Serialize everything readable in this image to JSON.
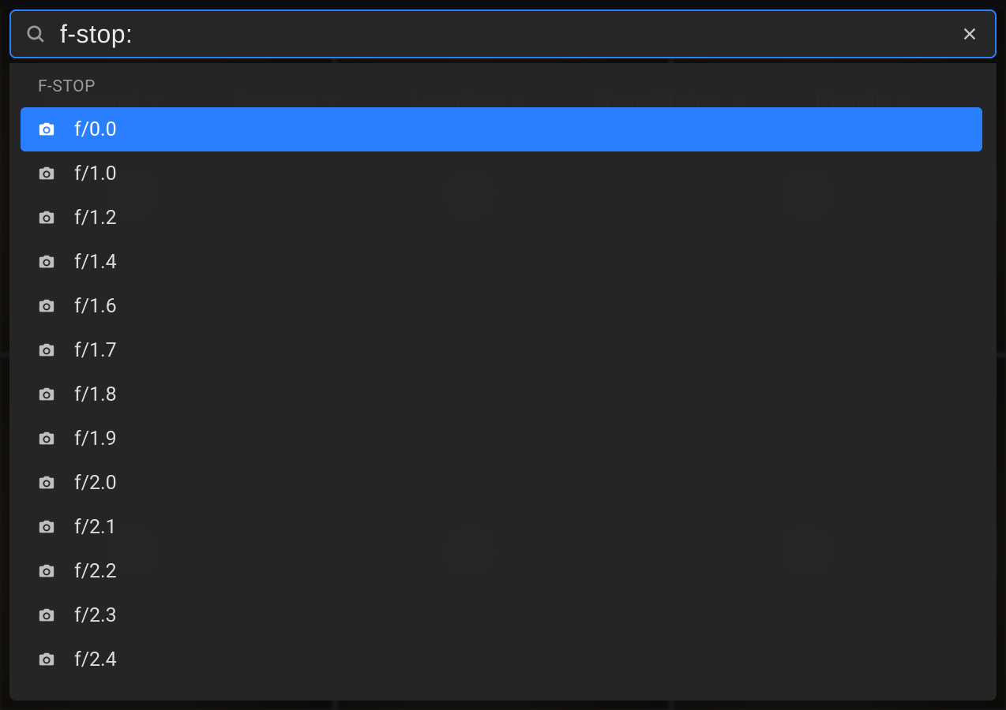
{
  "search": {
    "value": "f-stop:",
    "placeholder": "Search"
  },
  "filters": {
    "items": [
      {
        "label": "Keyword"
      },
      {
        "label": "Camera"
      },
      {
        "label": "Location"
      },
      {
        "label": "Sync Status"
      },
      {
        "label": "People"
      }
    ]
  },
  "dropdown": {
    "header": "F-STOP",
    "selected_index": 0,
    "options": [
      {
        "label": "f/0.0"
      },
      {
        "label": "f/1.0"
      },
      {
        "label": "f/1.2"
      },
      {
        "label": "f/1.4"
      },
      {
        "label": "f/1.6"
      },
      {
        "label": "f/1.7"
      },
      {
        "label": "f/1.8"
      },
      {
        "label": "f/1.9"
      },
      {
        "label": "f/2.0"
      },
      {
        "label": "f/2.1"
      },
      {
        "label": "f/2.2"
      },
      {
        "label": "f/2.3"
      },
      {
        "label": "f/2.4"
      }
    ]
  }
}
